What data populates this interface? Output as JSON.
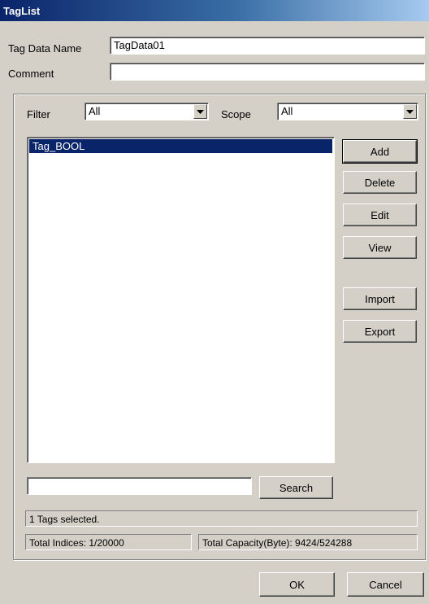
{
  "window": {
    "title": "TagList"
  },
  "form": {
    "tag_data_name_label": "Tag Data Name",
    "tag_data_name_value": "TagData01",
    "comment_label": "Comment",
    "comment_value": ""
  },
  "filter": {
    "filter_label": "Filter",
    "filter_value": "All",
    "scope_label": "Scope",
    "scope_value": "All"
  },
  "tag_list": {
    "items": [
      {
        "label": "Tag_BOOL",
        "selected": true
      }
    ]
  },
  "side_buttons": {
    "add": "Add",
    "delete": "Delete",
    "edit": "Edit",
    "view": "View",
    "import": "Import",
    "export": "Export"
  },
  "search": {
    "value": "",
    "button": "Search"
  },
  "status": {
    "selected": "1 Tags selected.",
    "indices": "Total Indices: 1/20000",
    "capacity": "Total Capacity(Byte): 9424/524288"
  },
  "footer": {
    "ok": "OK",
    "cancel": "Cancel"
  },
  "icons": {
    "dropdown": "chevron-down-icon"
  },
  "colors": {
    "titlebar_start": "#0a246a",
    "selection": "#0a246a",
    "dialog_bg": "#d4d0c8"
  }
}
